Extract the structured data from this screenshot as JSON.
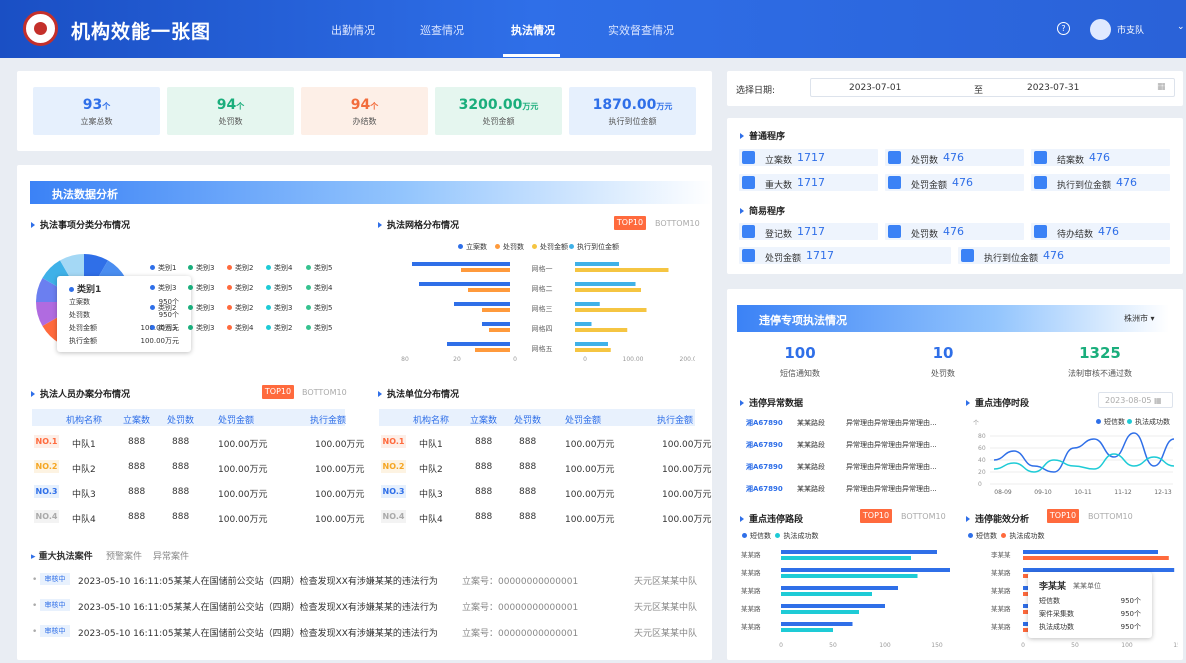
{
  "header": {
    "title": "机构效能一张图",
    "nav": [
      "出勤情况",
      "巡查情况",
      "执法情况",
      "实效督查情况"
    ],
    "help": "?",
    "user": "市支队"
  },
  "kpis": [
    {
      "value": "93",
      "unit": "个",
      "label": "立案总数",
      "color": "#2f6fe8",
      "bg": "#e6f0fd"
    },
    {
      "value": "94",
      "unit": "个",
      "label": "处罚数",
      "color": "#1aae7c",
      "bg": "#e5f6ef"
    },
    {
      "value": "94",
      "unit": "个",
      "label": "办结数",
      "color": "#f26d3d",
      "bg": "#fdefe7"
    },
    {
      "value": "3200.00",
      "unit": "万元",
      "label": "处罚金额",
      "color": "#1aae7c",
      "bg": "#e5f6ef"
    },
    {
      "value": "1870.00",
      "unit": "万元",
      "label": "执行到位金额",
      "color": "#2f6fe8",
      "bg": "#e6f0fd"
    }
  ],
  "date": {
    "label": "选择日期:",
    "start": "2023-07-01",
    "to": "至",
    "end": "2023-07-31"
  },
  "normal": {
    "title": "普通程序",
    "items": [
      {
        "label": "立案数",
        "value": "1717"
      },
      {
        "label": "处罚数",
        "value": "476"
      },
      {
        "label": "结案数",
        "value": "476"
      },
      {
        "label": "重大数",
        "value": "1717"
      },
      {
        "label": "处罚金额",
        "value": "476"
      },
      {
        "label": "执行到位金额",
        "value": "476"
      }
    ]
  },
  "simple": {
    "title": "简易程序",
    "items": [
      {
        "label": "登记数",
        "value": "1717"
      },
      {
        "label": "处罚数",
        "value": "476"
      },
      {
        "label": "待办结数",
        "value": "476"
      },
      {
        "label": "处罚金额",
        "value": "1717"
      },
      {
        "label": "执行到位金额",
        "value": "476"
      }
    ]
  },
  "analysis": {
    "title": "执法数据分析",
    "pie_title": "执法事项分类分布情况",
    "grid_title": "执法网格分布情况",
    "top": "TOP10",
    "bottom": "BOTTOM10",
    "pie_legend": [
      [
        "类别1",
        "类别3",
        "类别2",
        "类别4",
        "类别5"
      ],
      [
        "类别3",
        "类别3",
        "类别2",
        "类别5",
        "类别4"
      ],
      [
        "类别2",
        "类别3",
        "类别2",
        "类别3",
        "类别5"
      ],
      [
        "类别3",
        "类别3",
        "类别4",
        "类别2",
        "类别5"
      ]
    ],
    "tooltip": {
      "title": "类别1",
      "rows": [
        [
          "立案数",
          "950个"
        ],
        [
          "处罚数",
          "950个"
        ],
        [
          "处罚金额",
          "100.00万元"
        ],
        [
          "执行金额",
          "100.00万元"
        ]
      ]
    },
    "person_title": "执法人员办案分布情况",
    "unit_title": "执法单位分布情况",
    "person_cols": [
      "机构名称",
      "立案数",
      "处罚数",
      "处罚金额",
      "执行金额"
    ],
    "rows": [
      {
        "rank": "NO.1",
        "name": "中队1",
        "a": "888",
        "b": "888",
        "c": "100.00万元",
        "d": "100.00万元"
      },
      {
        "rank": "NO.2",
        "name": "中队2",
        "a": "888",
        "b": "888",
        "c": "100.00万元",
        "d": "100.00万元"
      },
      {
        "rank": "NO.3",
        "name": "中队3",
        "a": "888",
        "b": "888",
        "c": "100.00万元",
        "d": "100.00万元"
      },
      {
        "rank": "NO.4",
        "name": "中队4",
        "a": "888",
        "b": "888",
        "c": "100.00万元",
        "d": "100.00万元"
      }
    ],
    "cases_tabs": [
      "重大执法案件",
      "预警案件",
      "异常案件"
    ],
    "cases": [
      {
        "status": "审核中",
        "text": "2023-05-10 16:11:05某某人在国储前公交站（四期）检查发现XX有涉嫌某某的违法行为",
        "no": "立案号：00000000000001",
        "area": "天元区某某中队"
      },
      {
        "status": "审核中",
        "text": "2023-05-10 16:11:05某某人在国储前公交站（四期）检查发现XX有涉嫌某某的违法行为",
        "no": "立案号：00000000000001",
        "area": "天元区某某中队"
      },
      {
        "status": "审核中",
        "text": "2023-05-10 16:11:05某某人在国储前公交站（四期）检查发现XX有涉嫌某某的违法行为",
        "no": "立案号：00000000000001",
        "area": "天元区某某中队"
      }
    ]
  },
  "special": {
    "title": "违停专项执法情况",
    "city": "株洲市",
    "stats": [
      {
        "value": "100",
        "label": "短信通知数",
        "color": "#2f6fe8"
      },
      {
        "value": "10",
        "label": "处罚数",
        "color": "#2f6fe8"
      },
      {
        "value": "1325",
        "label": "法制审核不通过数",
        "color": "#1aae7c"
      }
    ],
    "abn_title": "违停异常数据",
    "abn": [
      {
        "plate": "湘A67890",
        "road": "某某路段",
        "desc": "异常理由异常理由异常理由..."
      },
      {
        "plate": "湘A67890",
        "road": "某某路段",
        "desc": "异常理由异常理由异常理由..."
      },
      {
        "plate": "湘A67890",
        "road": "某某路段",
        "desc": "异常理由异常理由异常理由..."
      },
      {
        "plate": "湘A67890",
        "road": "某某路段",
        "desc": "异常理由异常理由异常理由..."
      }
    ],
    "period_title": "重点违停时段",
    "period_date": "2023-08-05",
    "road_title": "重点违停路段",
    "eff_title": "违停能效分析",
    "tooltip2": {
      "name": "李某某",
      "unit": "某某单位",
      "rows": [
        [
          "短信数",
          "950个"
        ],
        [
          "案件采集数",
          "950个"
        ],
        [
          "执法成功数",
          "950个"
        ]
      ]
    }
  },
  "chart_data": [
    {
      "type": "bar",
      "title": "执法网格分布情况",
      "categories": [
        "网格一",
        "网格二",
        "网格三",
        "网格四",
        "网格五"
      ],
      "series": [
        {
          "name": "立案数",
          "values": [
            70,
            65,
            40,
            20,
            45
          ]
        },
        {
          "name": "处罚数",
          "values": [
            35,
            30,
            20,
            15,
            25
          ]
        },
        {
          "name": "处罚金额",
          "values": [
            80,
            110,
            45,
            30,
            60
          ]
        },
        {
          "name": "执行到位金额",
          "values": [
            170,
            120,
            130,
            95,
            65
          ]
        }
      ],
      "x_ticks": [
        "80",
        "20",
        "0",
        "0",
        "100.00",
        "200.00"
      ]
    },
    {
      "type": "line",
      "title": "重点违停时段",
      "x": [
        "08-09",
        "09-10",
        "10-11",
        "11-12",
        "12-13"
      ],
      "y_ticks": [
        "0",
        "20",
        "40",
        "60",
        "80"
      ],
      "y_unit": "个",
      "series": [
        {
          "name": "短信数",
          "values": [
            40,
            55,
            30,
            20,
            60,
            75,
            45,
            85,
            30,
            75
          ]
        },
        {
          "name": "执法成功数",
          "values": [
            25,
            35,
            20,
            40,
            30,
            25,
            50,
            30,
            45,
            30
          ]
        }
      ]
    },
    {
      "type": "bar",
      "title": "重点违停路段",
      "categories": [
        "某某路",
        "某某路",
        "某某路",
        "某某路",
        "某某路"
      ],
      "series": [
        {
          "name": "短信数",
          "values": [
            120,
            130,
            90,
            80,
            55
          ]
        },
        {
          "name": "执法成功数",
          "values": [
            100,
            105,
            70,
            60,
            40
          ]
        }
      ],
      "x_ticks": [
        "0",
        "50",
        "100",
        "150"
      ]
    },
    {
      "type": "bar",
      "title": "违停能效分析",
      "categories": [
        "李某某",
        "某某路",
        "某某路",
        "某某路",
        "某某路"
      ],
      "series": [
        {
          "name": "短信数",
          "values": [
            125,
            140,
            100,
            90,
            80
          ]
        },
        {
          "name": "执法成功数",
          "values": [
            135,
            110,
            80,
            70,
            60
          ]
        }
      ],
      "x_ticks": [
        "0",
        "50",
        "100",
        "150"
      ]
    }
  ]
}
